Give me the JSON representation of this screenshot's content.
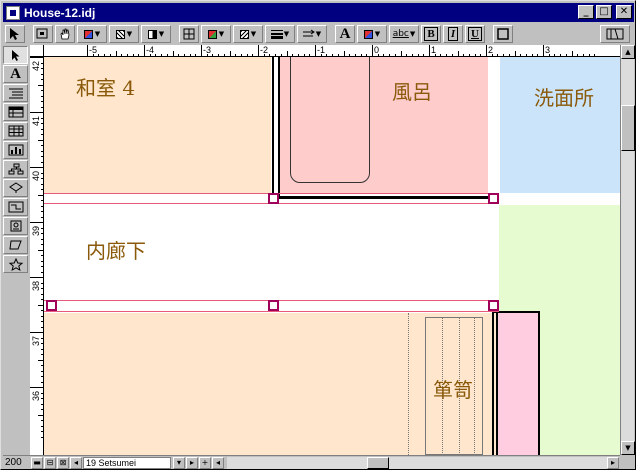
{
  "window": {
    "title": "House-12.idj",
    "minimize_glyph": "_",
    "maximize_glyph": "□",
    "close_glyph": "✕"
  },
  "toolbar": {
    "text_tool_glyph": "A",
    "text_style_glyph": "abc",
    "bold_label": "B",
    "italic_label": "I",
    "underline_label": "U"
  },
  "sidebar": {
    "text_tool_glyph": "A"
  },
  "rulers": {
    "horizontal": [
      "-5",
      "-4",
      "-3",
      "-2",
      "-1",
      "0",
      "1",
      "2",
      "3"
    ],
    "vertical": [
      "42",
      "41",
      "40",
      "39",
      "38",
      "37",
      "36"
    ]
  },
  "rooms": {
    "washitsu": "和室 4",
    "furo": "風呂",
    "senmenjo": "洗面所",
    "uchirouka": "内廊下",
    "tansu": "箪笥"
  },
  "status": {
    "zoom": "200",
    "layer_name": "19 Setsumei"
  },
  "colors": {
    "title_bar": "#000080",
    "washitsu": "#ffe6cc",
    "furo": "#ffcccc",
    "senmenjo": "#cce4fa",
    "green_room": "#e6fbcf",
    "closet": "#ffcce0",
    "label": "#8a5a0a",
    "handle": "#a0005a"
  }
}
